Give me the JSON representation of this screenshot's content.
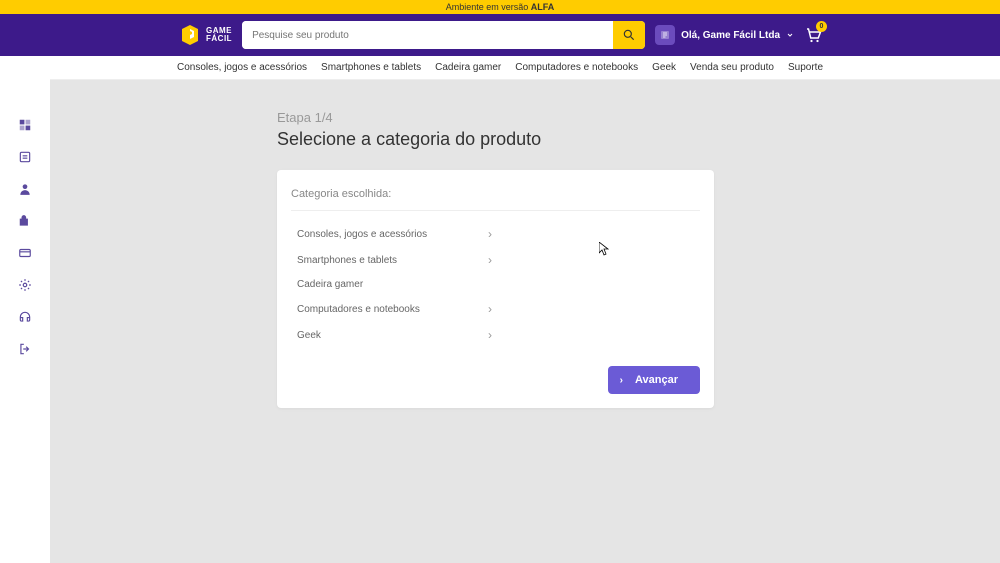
{
  "banner": {
    "prefix": "Ambiente em versão ",
    "bold": "ALFA"
  },
  "logo": {
    "line1": "GAME",
    "line2": "FÁCIL"
  },
  "search": {
    "placeholder": "Pesquise seu produto"
  },
  "user": {
    "greeting": "Olá, Game Fácil Ltda"
  },
  "cart": {
    "count": "0"
  },
  "nav": {
    "items": [
      "Consoles, jogos e acessórios",
      "Smartphones e tablets",
      "Cadeira gamer",
      "Computadores e notebooks",
      "Geek",
      "Venda seu produto",
      "Suporte"
    ]
  },
  "sidebar": {
    "icons": [
      "grid",
      "card",
      "user",
      "bag",
      "creditcard",
      "gear",
      "headset",
      "logout"
    ]
  },
  "page": {
    "step": "Etapa 1/4",
    "title": "Selecione a categoria do produto"
  },
  "card": {
    "header": "Categoria escolhida:",
    "categories": [
      {
        "label": "Consoles, jogos e acessórios",
        "has_children": true
      },
      {
        "label": "Smartphones e tablets",
        "has_children": true
      },
      {
        "label": "Cadeira gamer",
        "has_children": false
      },
      {
        "label": "Computadores e notebooks",
        "has_children": true
      },
      {
        "label": "Geek",
        "has_children": true
      }
    ],
    "advance": "Avançar"
  }
}
